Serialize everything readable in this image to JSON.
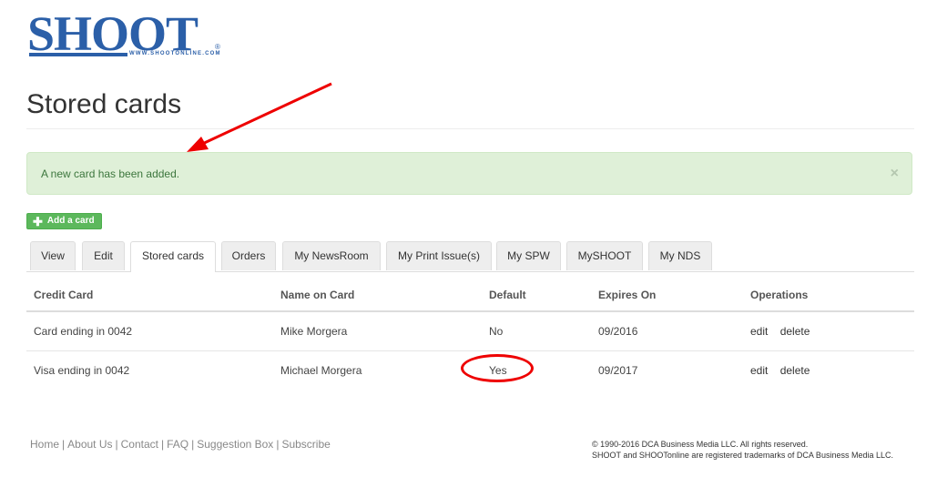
{
  "logo": {
    "word": "SHOOT",
    "url": "WWW.SHOOTONLINE.COM",
    "reg": "®"
  },
  "page": {
    "title": "Stored cards"
  },
  "alert": {
    "message": "A new card has been added.",
    "close": "×"
  },
  "add_card": {
    "label": "Add a card",
    "icon": "plus-icon"
  },
  "tabs": [
    "View",
    "Edit",
    "Stored cards",
    "Orders",
    "My NewsRoom",
    "My Print Issue(s)",
    "My SPW",
    "MySHOOT",
    "My NDS"
  ],
  "active_tab": "Stored cards",
  "table": {
    "headers": [
      "Credit Card",
      "Name on Card",
      "Default",
      "Expires On",
      "Operations"
    ],
    "rows": [
      {
        "card": "Card ending in 0042",
        "name": "Mike Morgera",
        "default": "No",
        "expires": "09/2016",
        "edit": "edit",
        "delete": "delete"
      },
      {
        "card": "Visa ending in 0042",
        "name": "Michael Morgera",
        "default": "Yes",
        "expires": "09/2017",
        "edit": "edit",
        "delete": "delete"
      }
    ]
  },
  "footer": {
    "links": [
      "Home",
      "About Us",
      "Contact",
      "FAQ",
      "Suggestion Box",
      "Subscribe"
    ],
    "separator": "|",
    "copyright_line1": "© 1990-2016 DCA Business Media LLC. All rights reserved.",
    "copyright_line2": "SHOOT and SHOOTonline are registered trademarks of DCA Business Media LLC."
  },
  "colors": {
    "brand": "#2b5fa8",
    "success": "#5cb85c",
    "alert_bg": "#dff0d8",
    "annotation": "#ee0000"
  }
}
